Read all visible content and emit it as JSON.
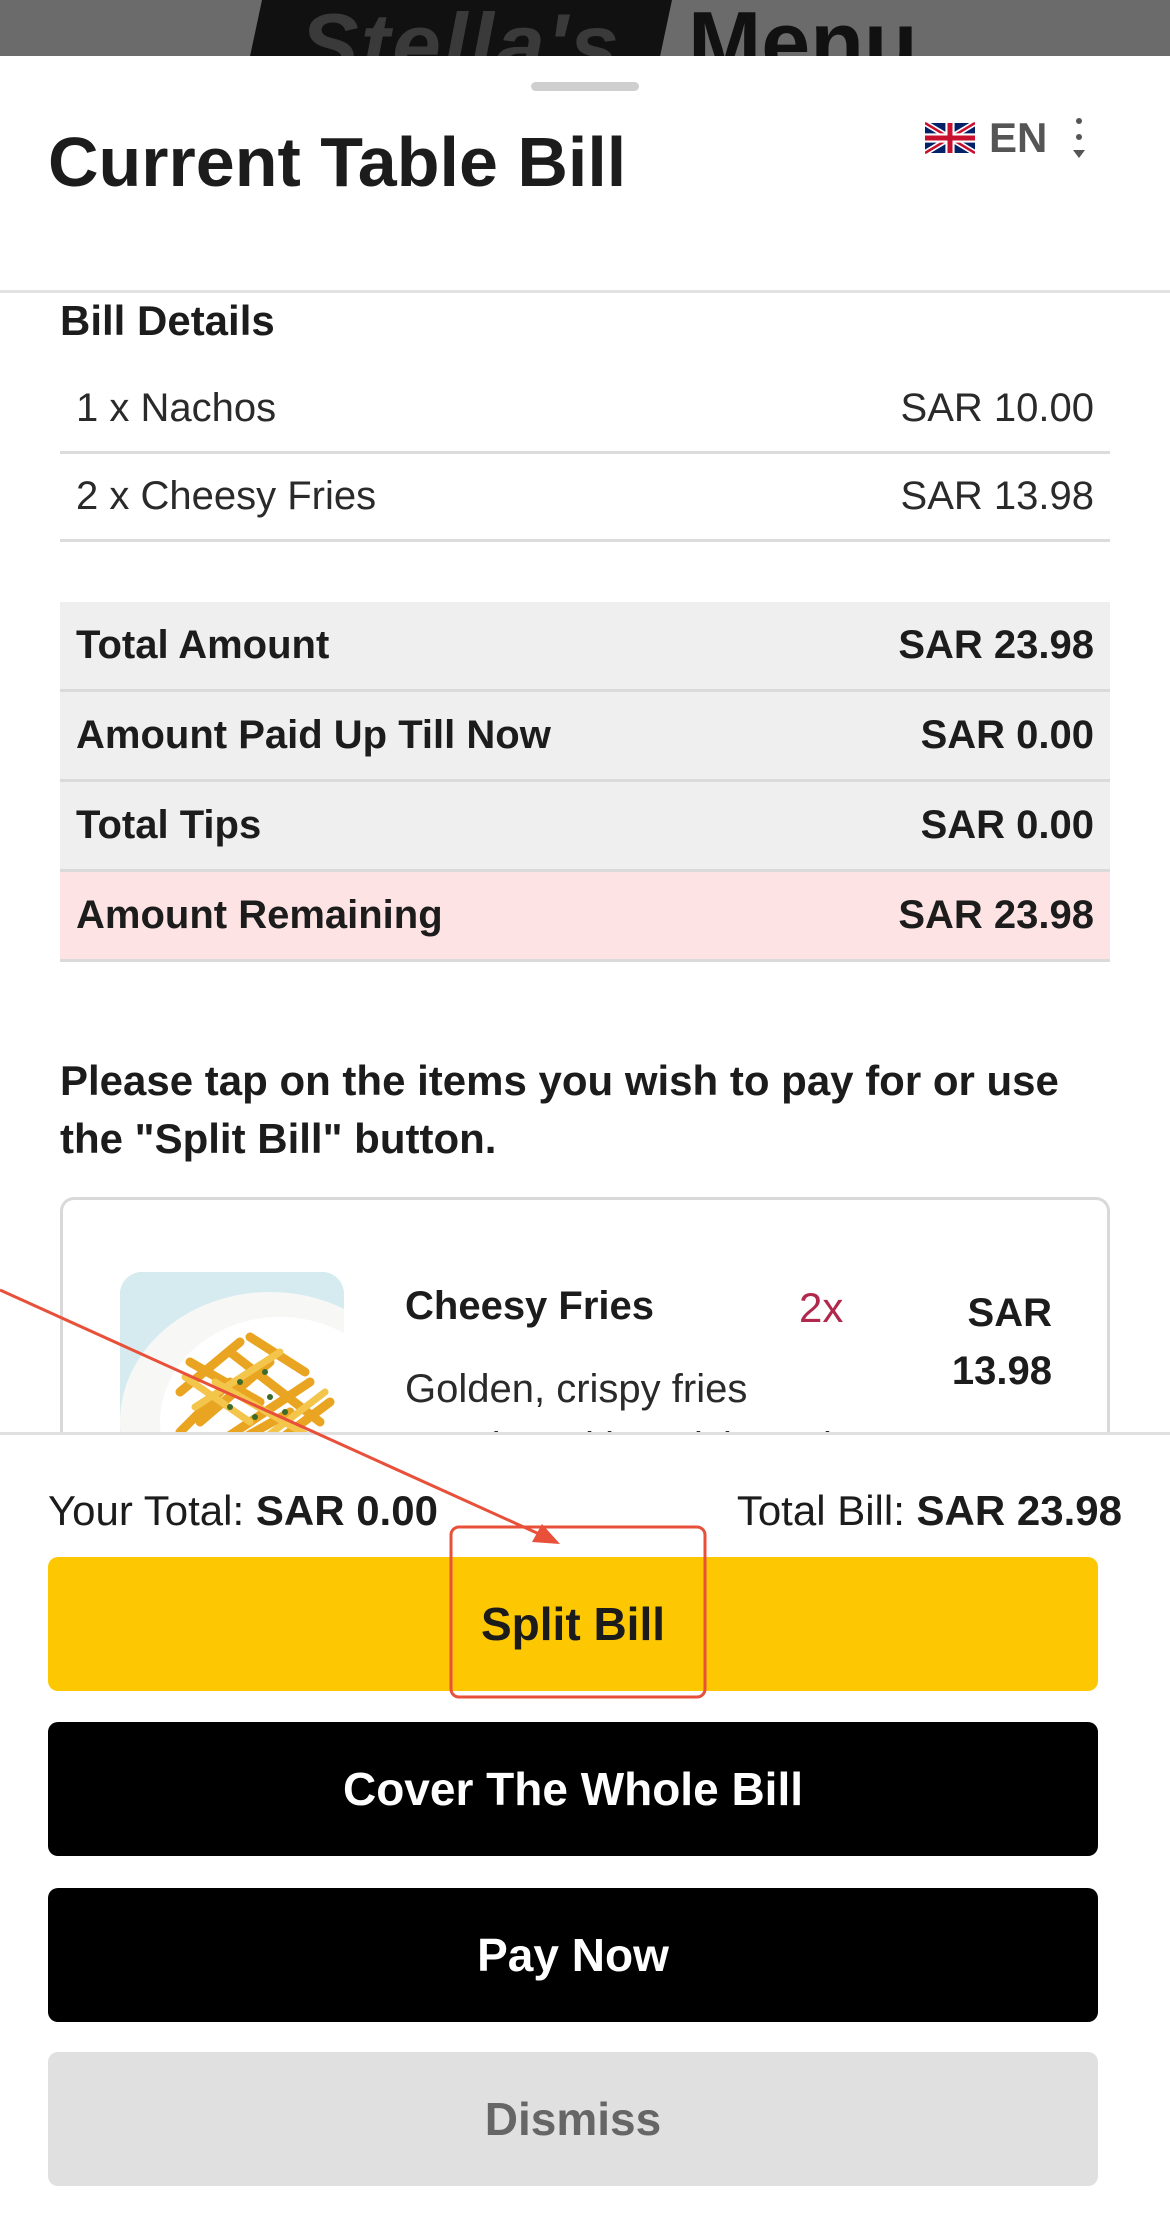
{
  "background": {
    "restaurant_name": "Stella's",
    "menu_label": "Menu"
  },
  "sheet": {
    "title": "Current Table Bill",
    "language": {
      "code": "EN",
      "flag_icon": "uk-flag-icon"
    },
    "menu_icon": "kebab-dropdown-icon"
  },
  "bill_details": {
    "title": "Bill Details",
    "items": [
      {
        "label": "1 x Nachos",
        "amount": "SAR 10.00"
      },
      {
        "label": "2 x Cheesy Fries",
        "amount": "SAR 13.98"
      }
    ],
    "summary": [
      {
        "label": "Total Amount",
        "amount": "SAR 23.98"
      },
      {
        "label": "Amount Paid Up Till Now",
        "amount": "SAR 0.00"
      },
      {
        "label": "Total Tips",
        "amount": "SAR 0.00"
      },
      {
        "label": "Amount Remaining",
        "amount": "SAR 23.98"
      }
    ]
  },
  "instruction": "Please tap on the items you wish to pay for or use the \"Split Bill\" button.",
  "item_card": {
    "name": "Cheesy Fries",
    "quantity": "2x",
    "price": "SAR 13.98",
    "description": "Golden, crispy fries smothered in a rich, mel"
  },
  "footer": {
    "your_total_label": "Your Total:",
    "your_total_value": "SAR 0.00",
    "total_bill_label": "Total Bill:",
    "total_bill_value": "SAR 23.98",
    "split_bill": "Split Bill",
    "cover_whole_bill": "Cover The Whole Bill",
    "pay_now": "Pay Now",
    "dismiss": "Dismiss"
  },
  "colors": {
    "split_button": "#fdc802",
    "primary_button": "#000000",
    "dismiss_button": "#e0e0e0",
    "remaining_row": "#fde3e4",
    "summary_row": "#efefef",
    "quantity_text": "#b0294d",
    "annotation": "#e8503a"
  }
}
